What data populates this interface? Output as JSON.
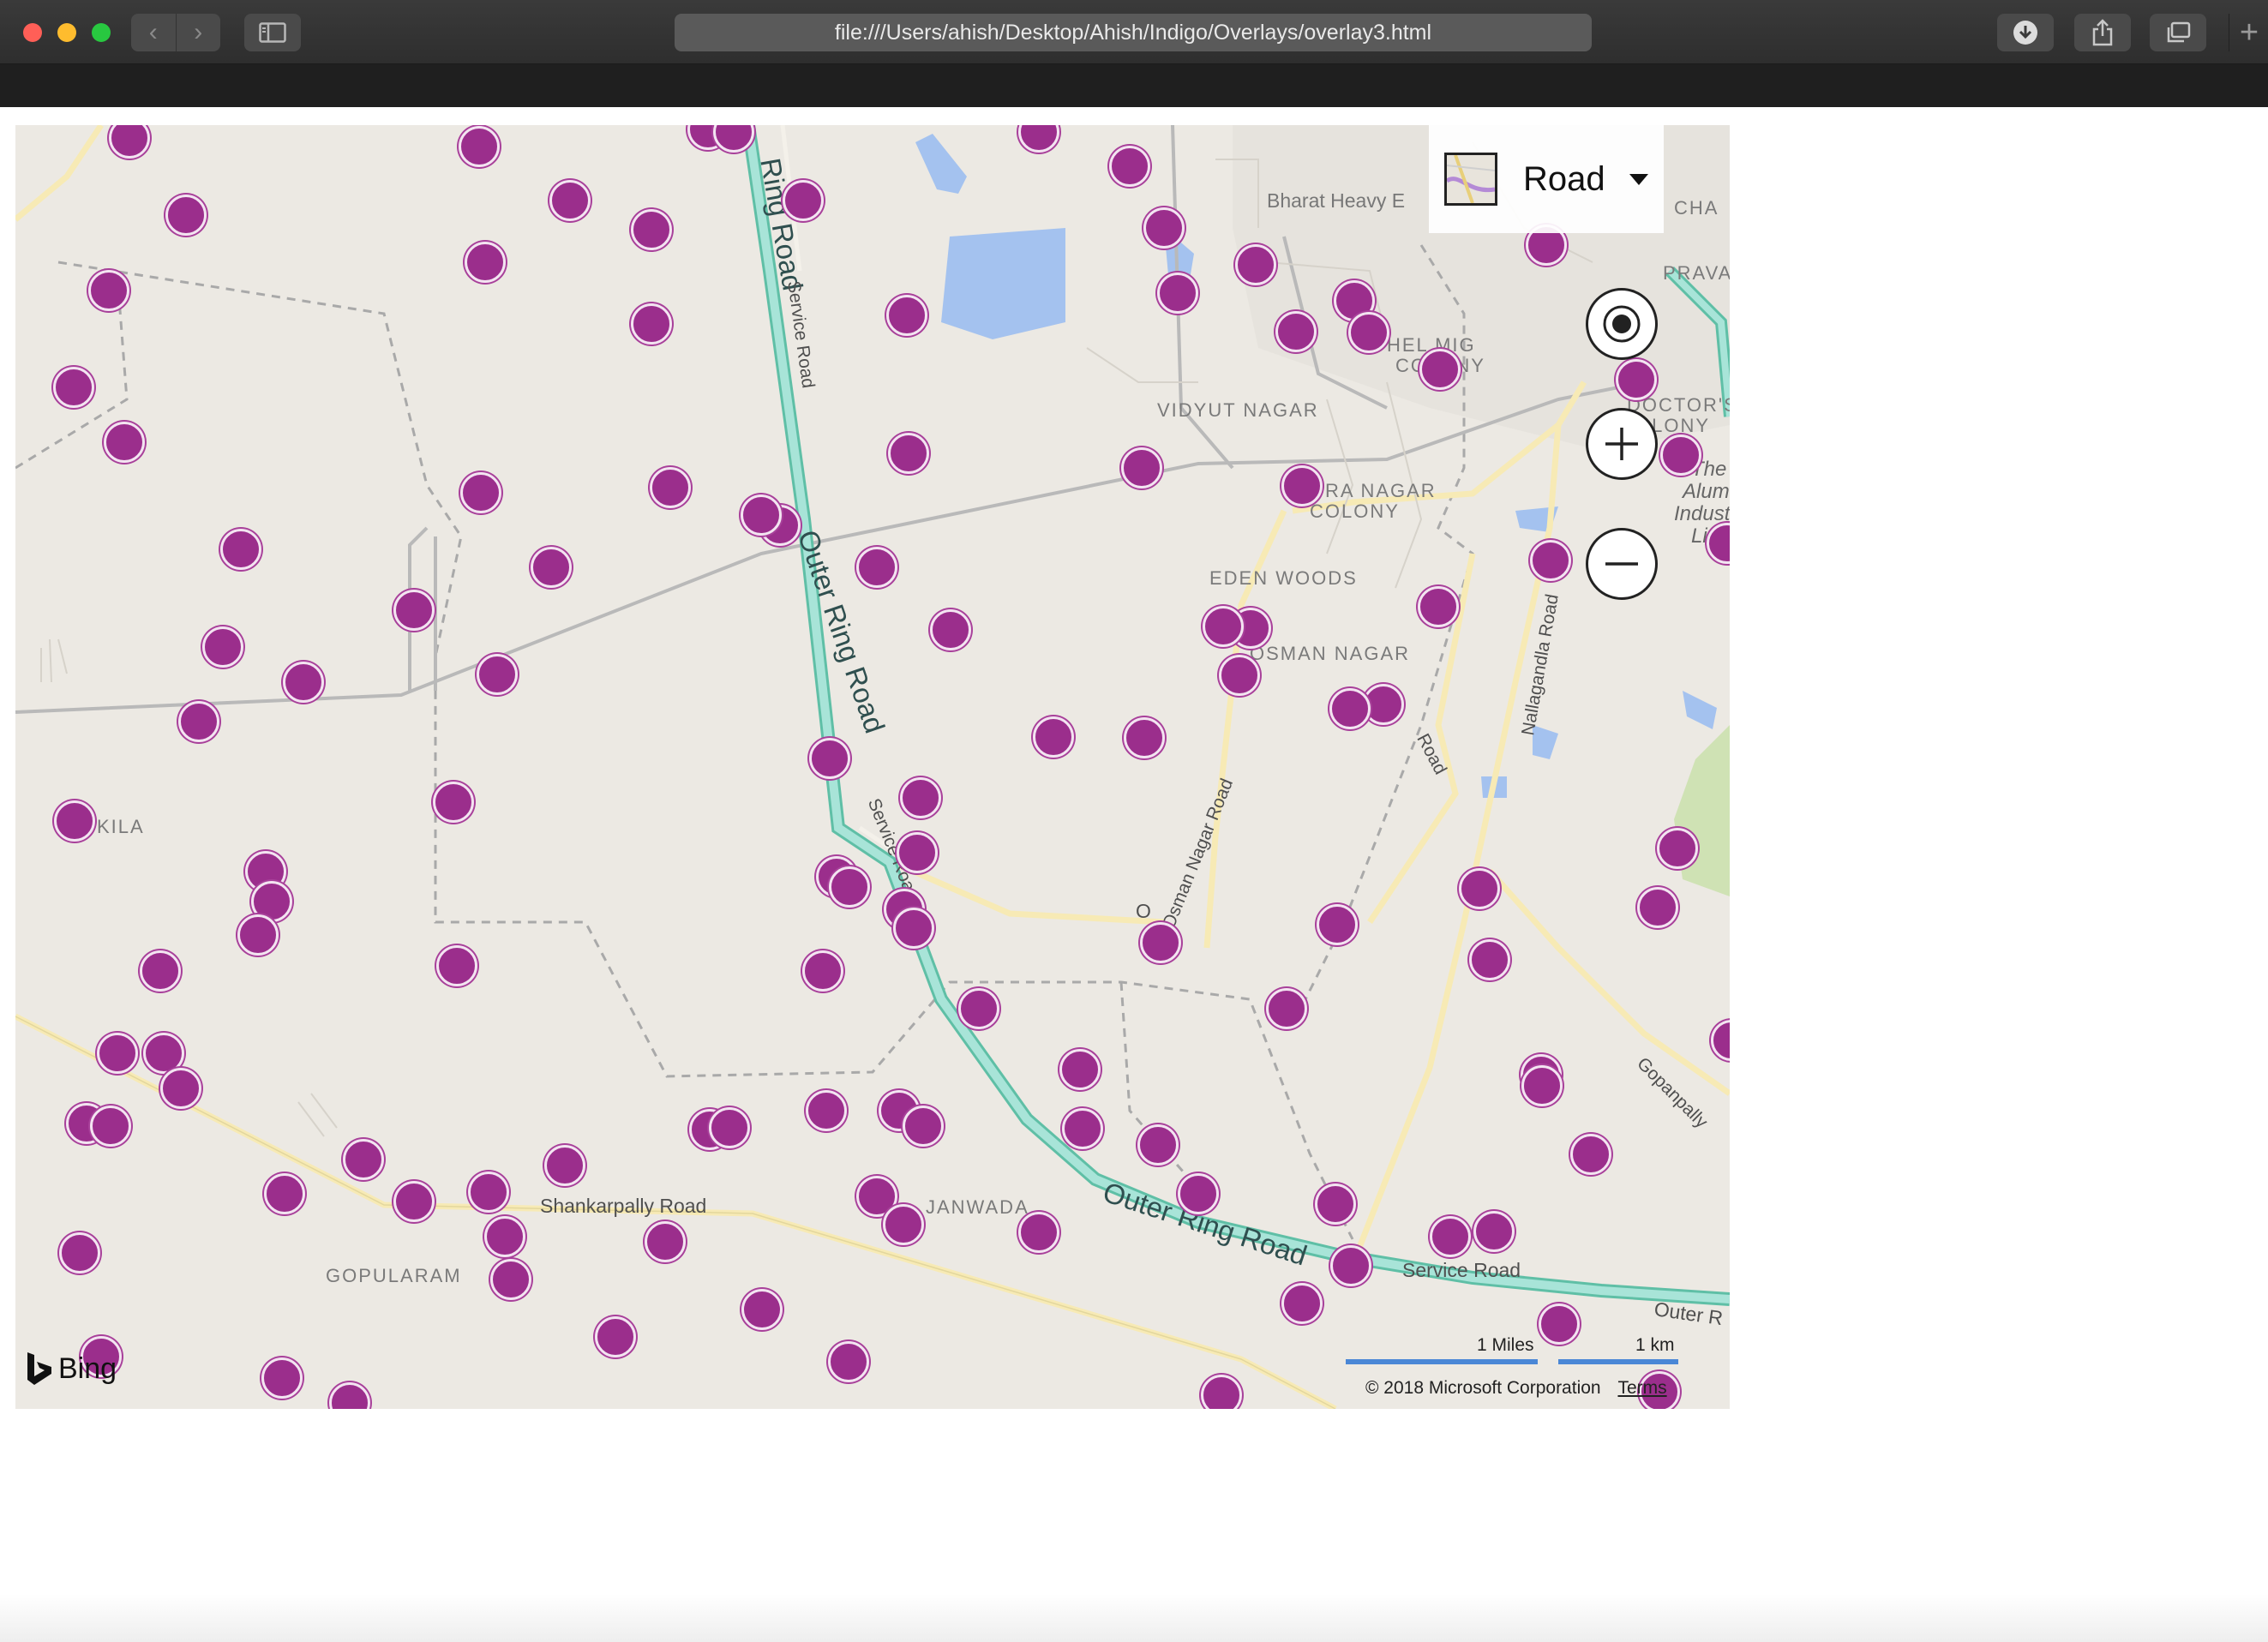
{
  "browser": {
    "url": "file:///Users/ahish/Desktop/Ahish/Indigo/Overlays/overlay3.html",
    "new_tab_symbol": "+"
  },
  "map": {
    "style_picker_label": "Road",
    "attribution_logo": "Bing",
    "copyright": "© 2018 Microsoft Corporation",
    "terms_label": "Terms",
    "scale_miles": "1 Miles",
    "scale_km": "1 km",
    "pin_color": "#9b2e8c",
    "places": [
      {
        "name": "Bharat Heavy E"
      },
      {
        "name": "CHA"
      },
      {
        "name": "PRAVAT"
      },
      {
        "name": "HEL MIG"
      },
      {
        "name": "COLONY"
      },
      {
        "name": "DOCTOR'S"
      },
      {
        "name": "OLONY"
      },
      {
        "name": "VIDYUT NAGAR"
      },
      {
        "name": "RA NAGAR"
      },
      {
        "name": "COLONY"
      },
      {
        "name": "EDEN WOODS"
      },
      {
        "name": "OSMAN NAGAR"
      },
      {
        "name": "KILA"
      },
      {
        "name": "GOPULARAM"
      },
      {
        "name": "JANWADA"
      },
      {
        "name": "The"
      },
      {
        "name": "Alumin"
      },
      {
        "name": "Industr"
      },
      {
        "name": "Lim"
      }
    ],
    "roads": [
      {
        "name": "Ring Road"
      },
      {
        "name": "Service Road"
      },
      {
        "name": "Outer Ring Road"
      },
      {
        "name": "Service Road"
      },
      {
        "name": "Osman Nagar Road"
      },
      {
        "name": "Nallagandla Road"
      },
      {
        "name": "Road"
      },
      {
        "name": "Gopanpally"
      },
      {
        "name": "Shankarpally Road"
      },
      {
        "name": "Outer Ring Road"
      },
      {
        "name": "Service Road"
      },
      {
        "name": "Outer R"
      },
      {
        "name": "O"
      }
    ]
  }
}
